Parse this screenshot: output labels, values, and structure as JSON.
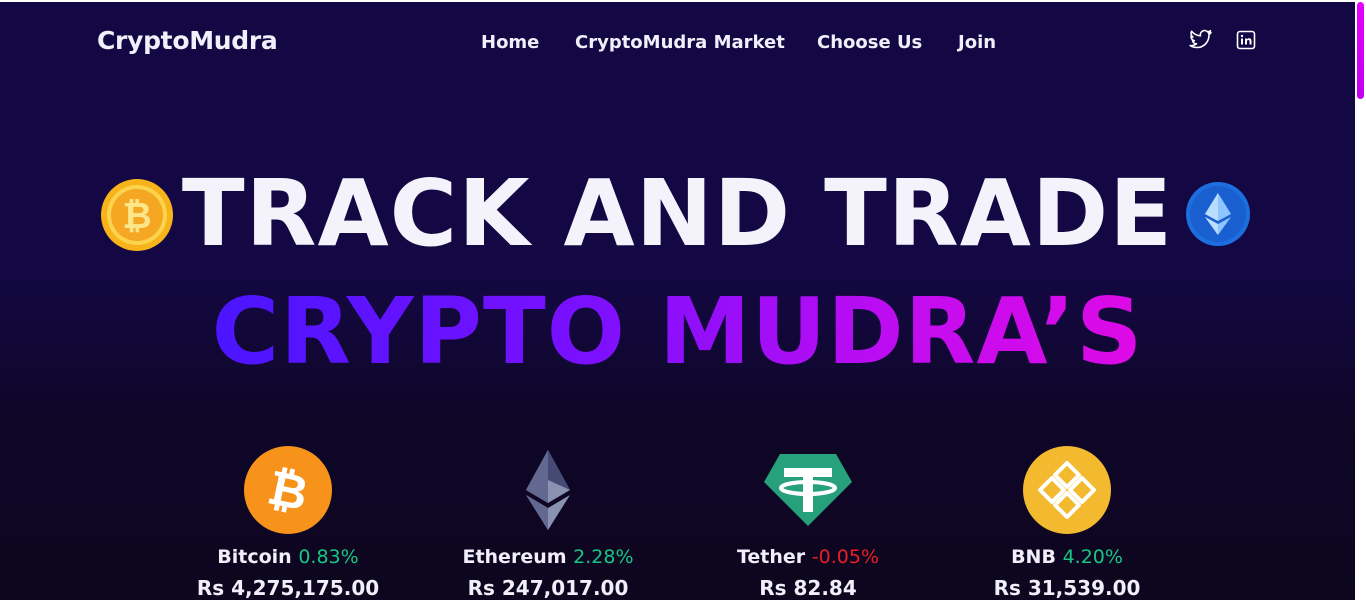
{
  "brand": {
    "name": "CryptoMudra"
  },
  "nav": {
    "items": [
      {
        "label": "Home"
      },
      {
        "label": "CryptoMudra Market"
      },
      {
        "label": "Choose Us"
      },
      {
        "label": "Join"
      }
    ]
  },
  "social": {
    "icons": [
      "twitter-icon",
      "linkedin-icon"
    ]
  },
  "hero": {
    "line1": "TRACK AND TRADE",
    "line2": "CRYPTO MUDRA’S",
    "gradient": [
      "#4b15ff",
      "#7a10ff",
      "#c20cf0",
      "#de0ae6"
    ]
  },
  "coins": [
    {
      "name": "Bitcoin",
      "change": "0.83%",
      "price": "Rs 4,275,175.00",
      "trend": "up",
      "icon": "bitcoin-icon"
    },
    {
      "name": "Ethereum",
      "change": "2.28%",
      "price": "Rs 247,017.00",
      "trend": "up",
      "icon": "ethereum-icon"
    },
    {
      "name": "Tether",
      "change": "-0.05%",
      "price": "Rs 82.84",
      "trend": "down",
      "icon": "tether-icon"
    },
    {
      "name": "BNB",
      "change": "4.20%",
      "price": "Rs 31,539.00",
      "trend": "up",
      "icon": "bnb-icon"
    }
  ],
  "colors": {
    "background": "#140844",
    "positive": "#16c784",
    "negative": "#ea1d24",
    "text": "#f1effa",
    "scrollbar_thumb": "#e600ff"
  }
}
